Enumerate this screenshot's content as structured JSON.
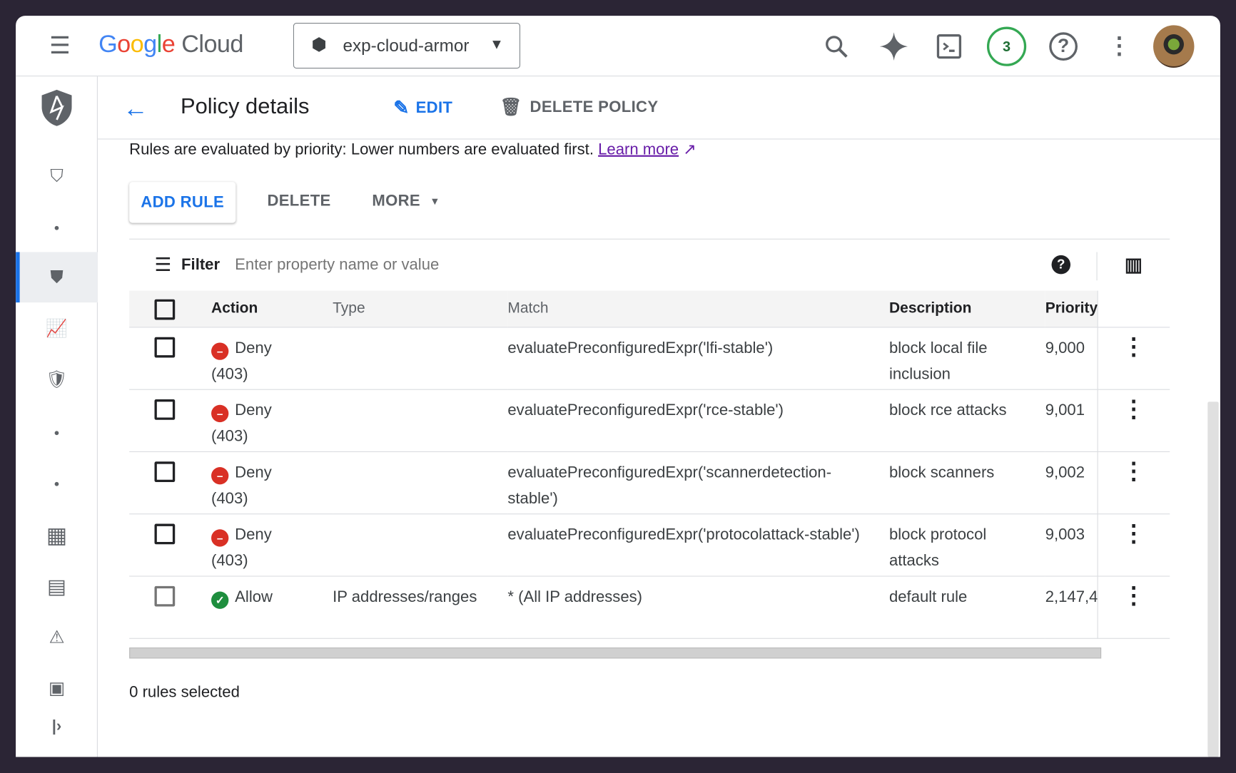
{
  "header": {
    "brand_google": "Google",
    "brand_cloud": "Cloud",
    "project": "exp-cloud-armor",
    "notifications": "3",
    "colors": {
      "g_blue": "#4285f4",
      "g_red": "#ea4335",
      "g_yellow": "#fbbc05",
      "g_green": "#34a853",
      "accent": "#1a73e8"
    }
  },
  "page": {
    "title": "Policy details",
    "edit": "EDIT",
    "delete_policy": "DELETE POLICY",
    "info": "Rules are evaluated by priority: Lower numbers are evaluated first.",
    "learn_more": "Learn more"
  },
  "toolbar": {
    "add_rule": "ADD RULE",
    "delete": "DELETE",
    "more": "MORE"
  },
  "filter": {
    "label": "Filter",
    "placeholder": "Enter property name or value"
  },
  "table": {
    "columns": [
      "Action",
      "Type",
      "Match",
      "Description",
      "Priority"
    ],
    "rows": [
      {
        "action": "Deny",
        "code": "(403)",
        "type": "",
        "match": "evaluatePreconfiguredExpr('lfi-stable')",
        "description": "block local file inclusion",
        "priority": "9,000"
      },
      {
        "action": "Deny",
        "code": "(403)",
        "type": "",
        "match": "evaluatePreconfiguredExpr('rce-stable')",
        "description": "block rce attacks",
        "priority": "9,001"
      },
      {
        "action": "Deny",
        "code": "(403)",
        "type": "",
        "match": "evaluatePreconfiguredExpr('scannerdetection-stable')",
        "description": "block scanners",
        "priority": "9,002"
      },
      {
        "action": "Deny",
        "code": "(403)",
        "type": "",
        "match": "evaluatePreconfiguredExpr('protocolattack-stable')",
        "description": "block protocol attacks",
        "priority": "9,003"
      },
      {
        "action": "Allow",
        "code": "",
        "type": "IP addresses/ranges",
        "match": "* (All IP addresses)",
        "description": "default rule",
        "priority": "2,147,4"
      }
    ]
  },
  "footer": {
    "selected": "0 rules selected"
  }
}
